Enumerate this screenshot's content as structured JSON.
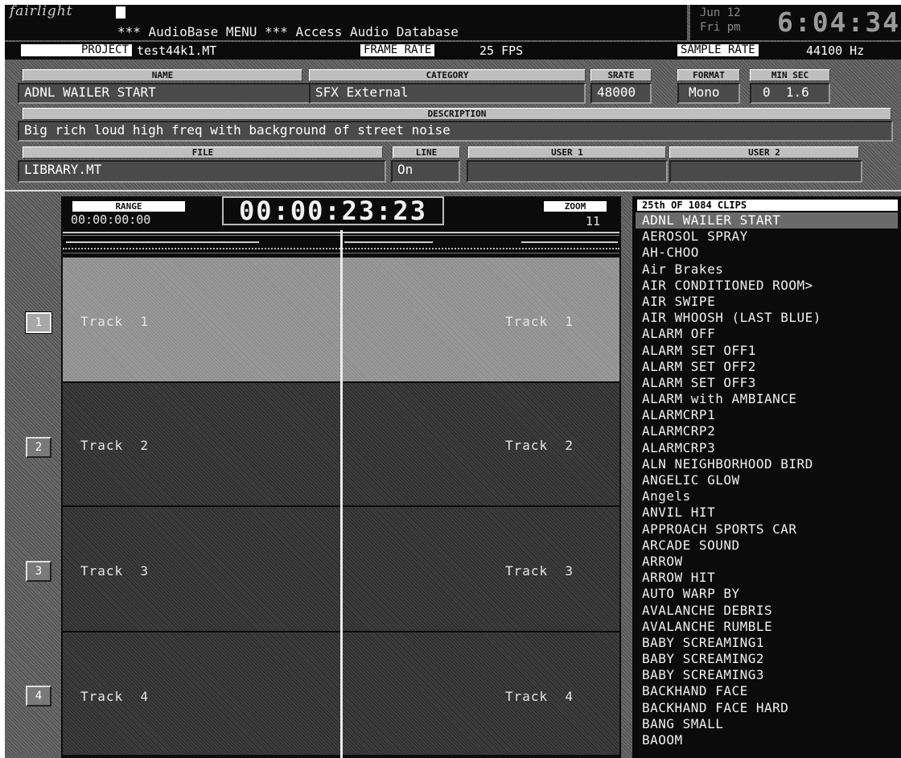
{
  "title_bar": {
    "logo": "fairlight",
    "title": "*** AudioBase MENU *** Access Audio Database",
    "date_line1": "Jun 12",
    "date_line2": "Fri pm",
    "time": "6:04:34"
  },
  "status_bar": {
    "project_label": "PROJECT",
    "project_value": "test44k1.MT",
    "frame_rate_label": "FRAME RATE",
    "frame_rate_value": "25 FPS",
    "sample_rate_label": "SAMPLE RATE",
    "sample_rate_value": "44100 Hz"
  },
  "details": {
    "name_header": "NAME",
    "name_value": "ADNL WAILER START",
    "category_header": "CATEGORY",
    "category_value": "SFX External",
    "srate_header": "SRATE",
    "srate_value": "48000",
    "format_header": "FORMAT",
    "format_value": "Mono",
    "minsec_header": "MIN SEC",
    "minsec_value": "0  1.6",
    "description_header": "DESCRIPTION",
    "description_value": "Big rich loud high freq with background of street noise",
    "file_header": "FILE",
    "file_value": "LIBRARY.MT",
    "line_header": "LINE",
    "line_value": "On",
    "user1_header": "USER 1",
    "user1_value": "",
    "user2_header": "USER 2",
    "user2_value": ""
  },
  "editor": {
    "range_label": "RANGE",
    "range_value": "00:00:00:00",
    "timecode": "00:00:23:23",
    "zoom_label": "ZOOM",
    "zoom_value": "11",
    "tracks": [
      {
        "num": "1",
        "label": "Track  1",
        "label_right": "Track  1"
      },
      {
        "num": "2",
        "label": "Track  2",
        "label_right": "Track  2"
      },
      {
        "num": "3",
        "label": "Track  3",
        "label_right": "Track  3"
      },
      {
        "num": "4",
        "label": "Track  4",
        "label_right": "Track  4"
      }
    ]
  },
  "clip_list": {
    "header": "25th OF 1084 CLIPS",
    "items": [
      "ADNL WAILER START",
      "AEROSOL SPRAY",
      "AH-CHOO",
      "Air Brakes",
      "AIR CONDITIONED ROOM>",
      "AIR SWIPE",
      "AIR WHOOSH (LAST BLUE)",
      "ALARM OFF",
      "ALARM SET OFF1",
      "ALARM SET OFF2",
      "ALARM SET OFF3",
      "ALARM with AMBIANCE",
      "ALARMCRP1",
      "ALARMCRP2",
      "ALARMCRP3",
      "ALN NEIGHBORHOOD BIRD",
      "ANGELIC GLOW",
      "Angels",
      "ANVIL HIT",
      "APPROACH SPORTS CAR",
      "ARCADE SOUND",
      "ARROW",
      "ARROW HIT",
      "AUTO WARP BY",
      "AVALANCHE DEBRIS",
      "AVALANCHE RUMBLE",
      "BABY SCREAMING1",
      "BABY SCREAMING2",
      "BABY SCREAMING3",
      "BACKHAND FACE",
      "BACKHAND FACE HARD",
      "BANG SMALL",
      "BAOOM"
    ]
  },
  "colors": {
    "selected_track": "#9a9a9a",
    "track": "#3e3e3e",
    "background": "#0b0b0b"
  }
}
